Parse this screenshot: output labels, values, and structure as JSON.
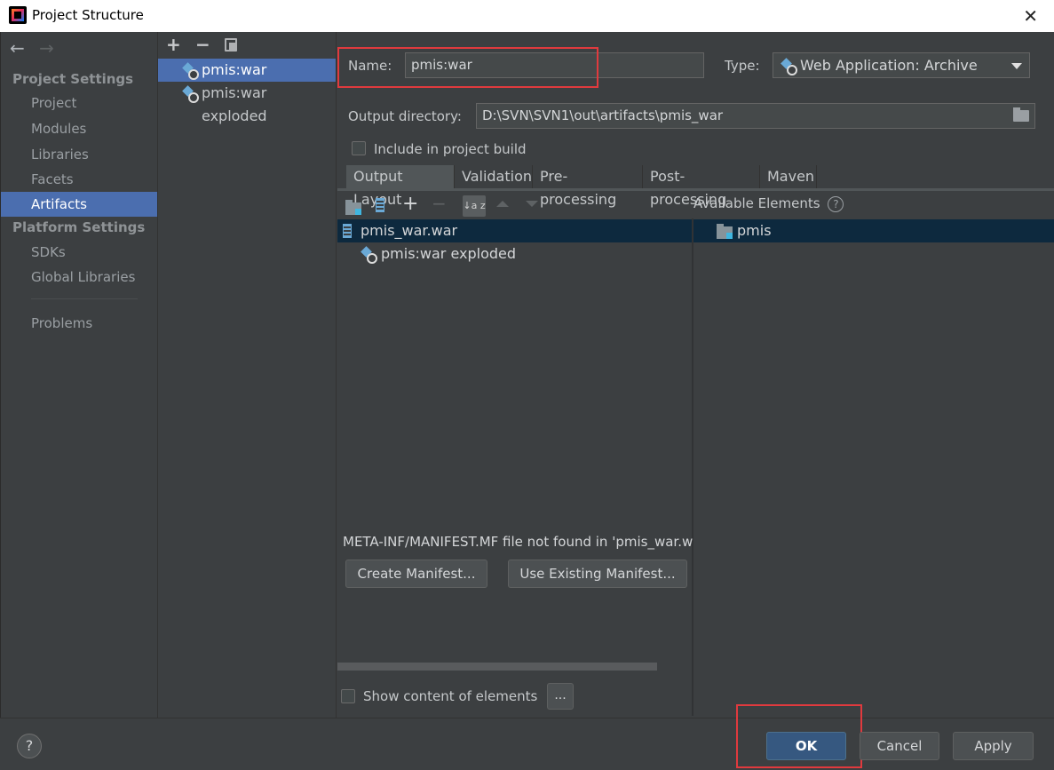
{
  "window": {
    "title": "Project Structure",
    "close_glyph": "✕"
  },
  "nav": {
    "back_glyph": "←",
    "forward_glyph": "→",
    "project_settings_heading": "Project Settings",
    "platform_settings_heading": "Platform Settings",
    "items": {
      "project": "Project",
      "modules": "Modules",
      "libraries": "Libraries",
      "facets": "Facets",
      "artifacts": "Artifacts",
      "sdks": "SDKs",
      "global_libraries": "Global Libraries",
      "problems": "Problems"
    },
    "selected": "Artifacts"
  },
  "artifact_list": {
    "add_glyph": "+",
    "remove_glyph": "−",
    "items": [
      "pmis:war",
      "pmis:war exploded"
    ],
    "selected_index": 0
  },
  "editor": {
    "name_label": "Name:",
    "name_value": "pmis:war",
    "type_label": "Type:",
    "type_value": "Web Application: Archive",
    "output_dir_label": "Output directory:",
    "output_dir_value": "D:\\SVN\\SVN1\\out\\artifacts\\pmis_war",
    "include_in_build_label": "Include in project build",
    "include_in_build_checked": false,
    "tabs": [
      "Output Layout",
      "Validation",
      "Pre-processing",
      "Post-processing",
      "Maven"
    ],
    "active_tab": "Output Layout",
    "available_elements_label": "Available Elements",
    "help_glyph": "?",
    "sort_glyph": "↓a z",
    "layout_tree": {
      "root": "pmis_war.war",
      "children": [
        "pmis:war exploded"
      ]
    },
    "available_tree": [
      "pmis"
    ],
    "manifest_message": "META-INF/MANIFEST.MF file not found in 'pmis_war.w",
    "create_manifest_label": "Create Manifest...",
    "use_existing_manifest_label": "Use Existing Manifest...",
    "show_content_label": "Show content of elements",
    "show_content_checked": false,
    "ellipsis_label": "..."
  },
  "footer": {
    "help_label": "?",
    "ok_label": "OK",
    "cancel_label": "Cancel",
    "apply_label": "Apply"
  },
  "colors": {
    "background": "#3c3f41",
    "selection": "#4b6eaf",
    "tree_selection": "#0d293e",
    "ok_button": "#365880",
    "highlight_box": "#e03a3e"
  }
}
